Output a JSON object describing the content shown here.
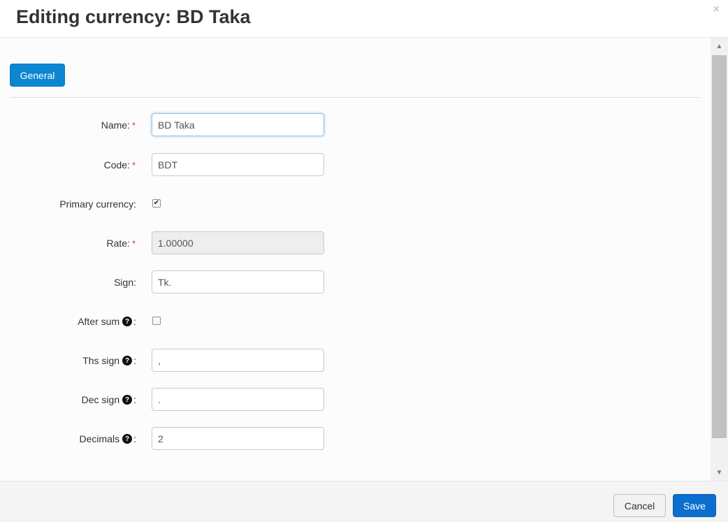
{
  "dialog": {
    "title": "Editing currency: BD Taka",
    "close_icon": "×"
  },
  "tabs": [
    {
      "label": "General",
      "active": true
    }
  ],
  "form": {
    "name": {
      "label": "Name:",
      "required": "*",
      "value": "BD Taka"
    },
    "code": {
      "label": "Code:",
      "required": "*",
      "value": "BDT"
    },
    "primary": {
      "label": "Primary currency:",
      "checked": true
    },
    "rate": {
      "label": "Rate:",
      "required": "*",
      "value": "1.00000",
      "disabled": true
    },
    "sign": {
      "label": "Sign:",
      "value": "Tk."
    },
    "after_sum": {
      "label": "After sum",
      "help_icon": "?",
      "colon": ":",
      "checked": false
    },
    "ths_sign": {
      "label": "Ths sign",
      "help_icon": "?",
      "colon": ":",
      "value": ","
    },
    "dec_sign": {
      "label": "Dec sign",
      "help_icon": "?",
      "colon": ":",
      "value": "."
    },
    "decimals": {
      "label": "Decimals",
      "help_icon": "?",
      "colon": ":",
      "value": "2"
    }
  },
  "footer": {
    "cancel_label": "Cancel",
    "save_label": "Save"
  },
  "colors": {
    "primary": "#0c86d1",
    "save": "#0b6fd0",
    "required": "#e4393c"
  },
  "icons": {
    "close": "close-icon",
    "help": "question-circle-icon",
    "check": "checkmark-icon",
    "scroll_up": "triangle-up-icon",
    "scroll_down": "triangle-down-icon"
  }
}
